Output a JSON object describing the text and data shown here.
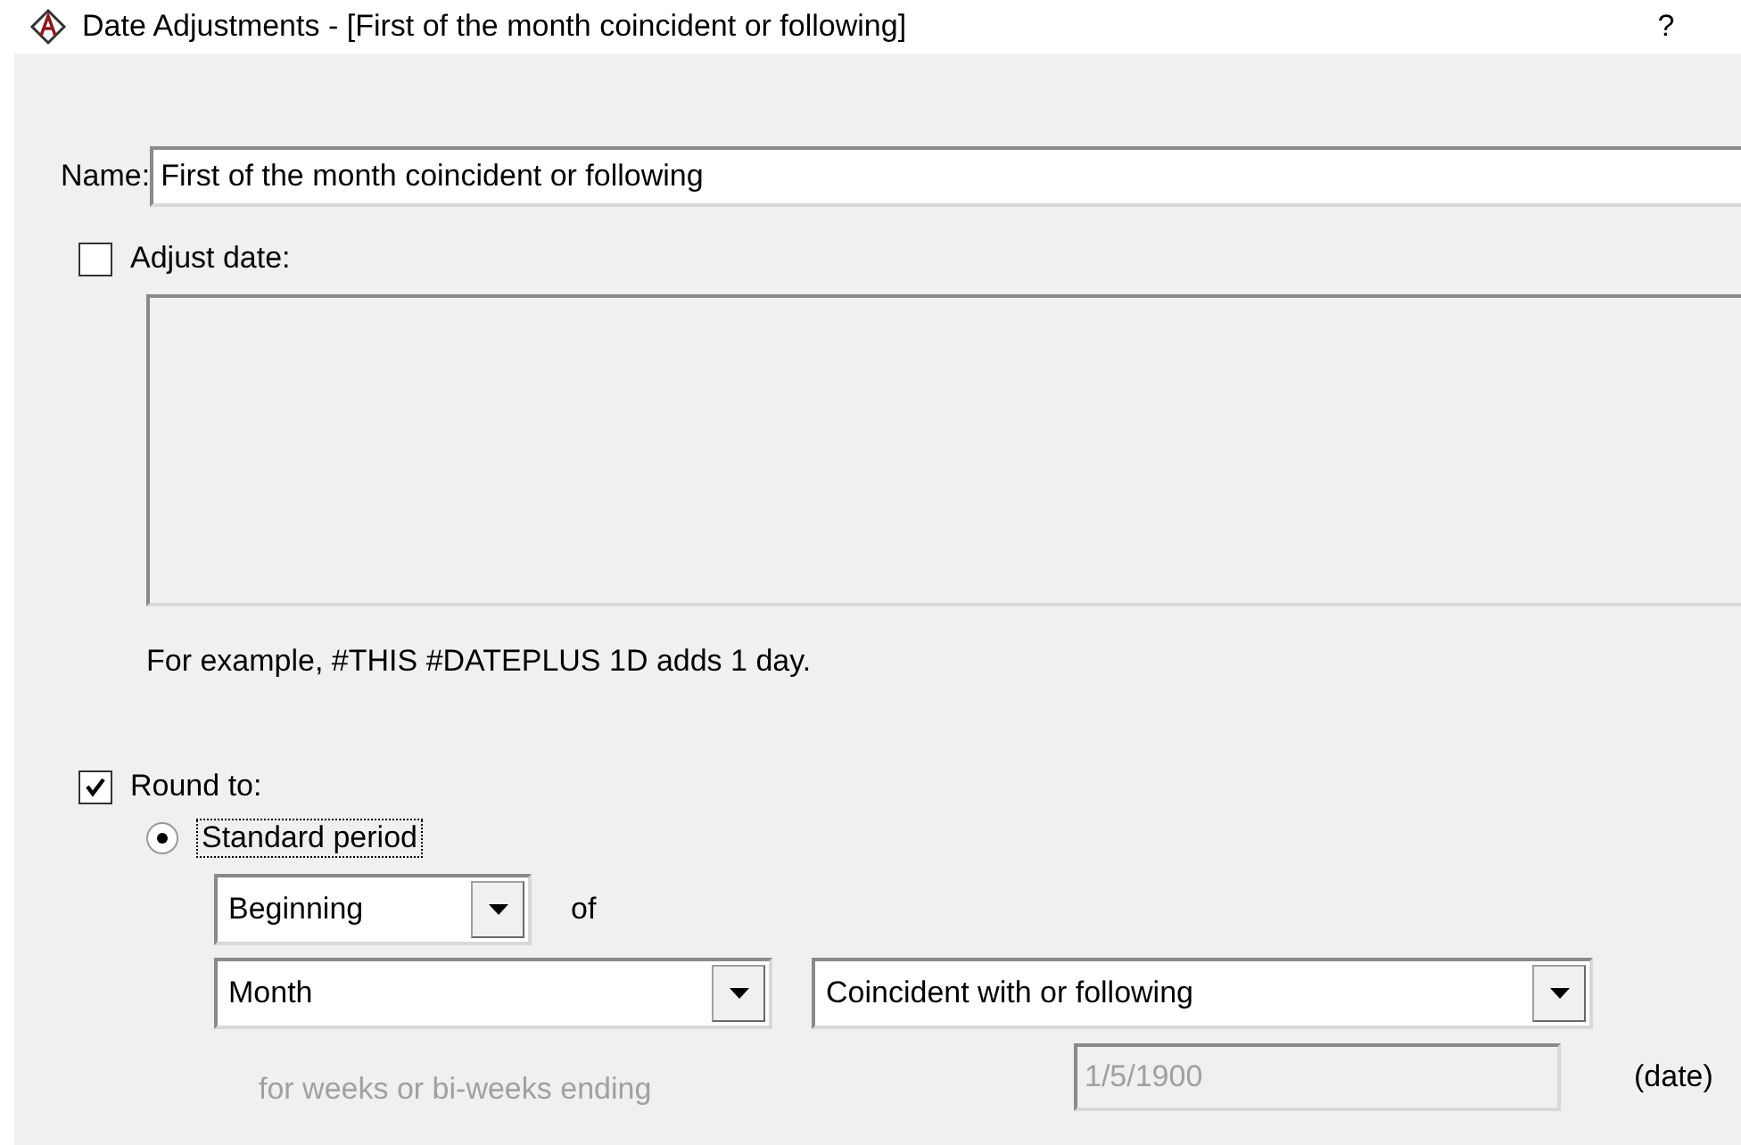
{
  "window": {
    "title": "Date Adjustments - [First of the month coincident or following]",
    "help_button": "?"
  },
  "name_field": {
    "label": "Name:",
    "value": "First of the month coincident or following"
  },
  "adjust_date": {
    "label": "Adjust date:",
    "checked": false
  },
  "expression_box": {
    "disabled": true
  },
  "example_text": "For example, #THIS #DATEPLUS 1D adds 1 day.",
  "round_to": {
    "label": "Round to:",
    "checked": true
  },
  "period_options": [
    {
      "label": "Standard period",
      "selected": true
    }
  ],
  "position_select": {
    "value": "Beginning"
  },
  "of_label": "of",
  "period_select": {
    "value": "Month"
  },
  "direction_select": {
    "value": "Coincident with or following"
  },
  "week_ending": {
    "label": "for weeks or bi-weeks ending",
    "value": "1/5/1900",
    "disabled": true,
    "unit": "(date)"
  }
}
